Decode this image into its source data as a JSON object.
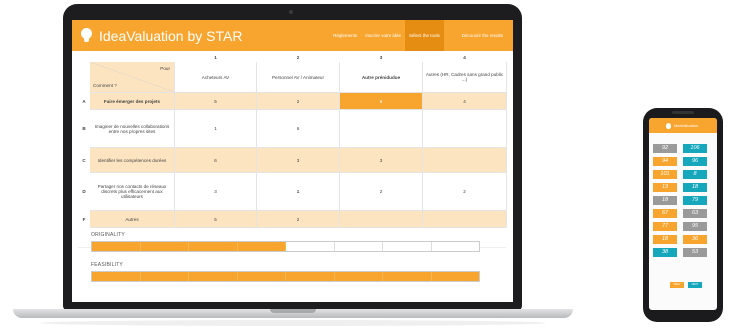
{
  "app": {
    "title": "IdeaValuation by STAR",
    "nav": [
      "Réglements",
      "Inscrire votre idée",
      "Sélect the tools",
      "Découvrir the results"
    ],
    "active_nav_index": 2
  },
  "table": {
    "corner_top": "Pour",
    "corner_bottom": "Comment ?",
    "columns": [
      {
        "num": "1",
        "label": "Acheteurs AV"
      },
      {
        "num": "2",
        "label": "Personnel AV / Animateur"
      },
      {
        "num": "3",
        "label": "Autre prénidudue"
      },
      {
        "num": "4",
        "label": "Autres (HR, Cadres sans grand public ...)"
      }
    ],
    "rows": [
      {
        "letter": "A",
        "label": "Faire émerger des projets",
        "cells": [
          "5",
          "2",
          "6",
          "4"
        ]
      },
      {
        "letter": "B",
        "label": "Imaginer de nouvelles collaborations entre nos propres sites",
        "cells": [
          "1",
          "6",
          "",
          ""
        ]
      },
      {
        "letter": "C",
        "label": "Identifier les compétences durées",
        "cells": [
          "6",
          "3",
          "3",
          ""
        ]
      },
      {
        "letter": "D",
        "label": "Partager nos contacts de réseaux discrets plus efficacement aux utilisateurs",
        "cells": [
          "3",
          "1",
          "2",
          "2"
        ]
      },
      {
        "letter": "F",
        "label": "Autres",
        "cells": [
          "5",
          "2",
          "",
          ""
        ]
      }
    ],
    "highlight_cell": {
      "row": 0,
      "col": 2
    }
  },
  "scores": [
    {
      "label": "ORIGINALITY",
      "segments": 8,
      "filled": 4
    },
    {
      "label": "FEASIBILITY",
      "segments": 8,
      "filled": 8
    }
  ],
  "mobile": {
    "title": "IdeaValuation",
    "tiles": [
      {
        "value": "92",
        "color": "#9a9a9a"
      },
      {
        "value": "106",
        "color": "#16a7bd"
      },
      {
        "value": "94",
        "color": "#f7a52f"
      },
      {
        "value": "96",
        "color": "#16a7bd"
      },
      {
        "value": "101",
        "color": "#f7a52f"
      },
      {
        "value": "8",
        "color": "#16a7bd"
      },
      {
        "value": "13",
        "color": "#f7a52f"
      },
      {
        "value": "18",
        "color": "#16a7bd"
      },
      {
        "value": "18",
        "color": "#9a9a9a"
      },
      {
        "value": "79",
        "color": "#16a7bd"
      },
      {
        "value": "67",
        "color": "#f7a52f"
      },
      {
        "value": "63",
        "color": "#9a9a9a"
      },
      {
        "value": "77",
        "color": "#f7a52f"
      },
      {
        "value": "95",
        "color": "#9a9a9a"
      },
      {
        "value": "18",
        "color": "#f7a52f"
      },
      {
        "value": "36",
        "color": "#f7a52f"
      },
      {
        "value": "38",
        "color": "#16a7bd"
      },
      {
        "value": "53",
        "color": "#9a9a9a"
      }
    ],
    "buttons": [
      {
        "label": "PREV",
        "color": "#f7a52f"
      },
      {
        "label": "NEXT",
        "color": "#16a7bd"
      }
    ]
  },
  "colors": {
    "accent": "#f7a52f",
    "accent_dark": "#e48d12",
    "band": "#fde4c0",
    "teal": "#16a7bd",
    "grey_tile": "#9a9a9a"
  }
}
